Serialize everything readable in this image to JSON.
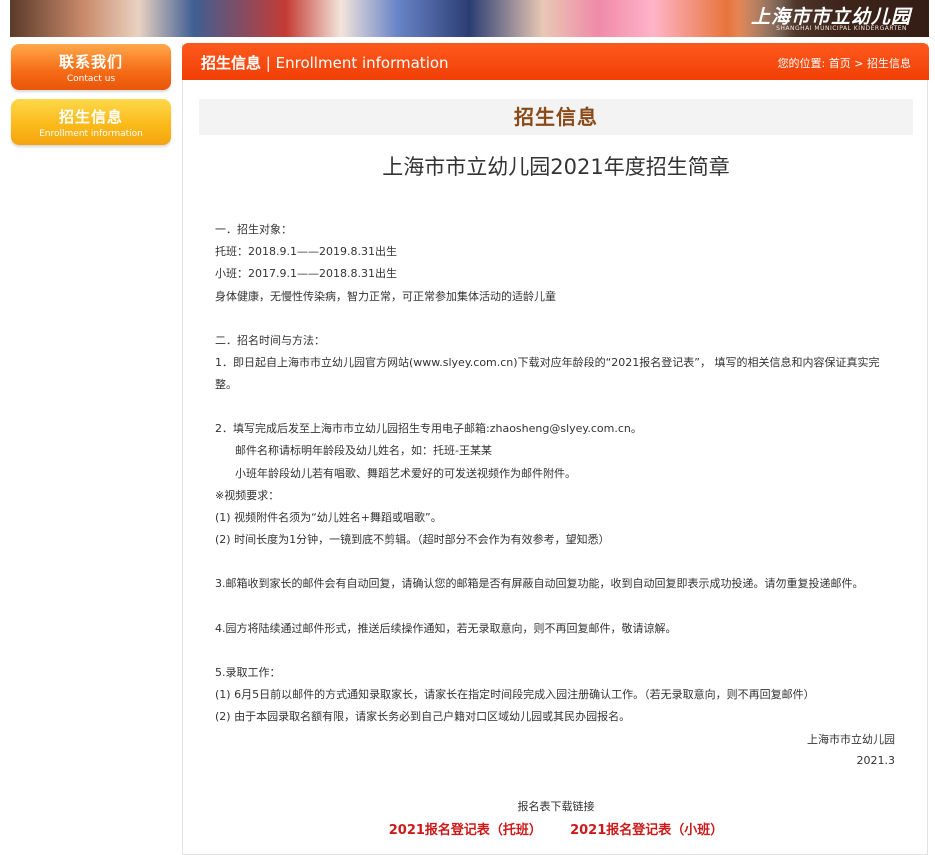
{
  "banner": {
    "logo_cn": "上海市市立幼儿园",
    "logo_en": "SHANGHAI MUNICIPAL KINDERGARTEN"
  },
  "sidebar": {
    "items": [
      {
        "label_cn": "联系我们",
        "label_en": "Contact  us"
      },
      {
        "label_cn": "招生信息",
        "label_en": "Enrollment information"
      }
    ]
  },
  "header": {
    "title_cn": "招生信息",
    "title_sep": "|",
    "title_en": "Enrollment information",
    "crumb_prefix": "您的位置:",
    "crumb_home": "首页",
    "crumb_arrow": ">",
    "crumb_current": "招生信息"
  },
  "page": {
    "heading": "招生信息",
    "doc_title": "上海市市立幼儿园2021年度招生简章"
  },
  "content": {
    "lines": [
      "一．招生对象：",
      "托班：2018.9.1——2019.8.31出生",
      "小班：2017.9.1——2018.8.31出生",
      "身体健康，无慢性传染病，智力正常，可正常参加集体活动的适龄儿童",
      "二．招名时间与方法：",
      "1．即日起自上海市市立幼儿园官方网站(www.slyey.com.cn)下载对应年龄段的“2021报名登记表”，  填写的相关信息和内容保证真实完",
      "整。",
      "2．填写完成后发至上海市市立幼儿园招生专用电子邮箱:zhaosheng@slyey.com.cn。",
      "邮件名称请标明年龄段及幼儿姓名，如：托班-王某某",
      "小班年龄段幼儿若有唱歌、舞蹈艺术爱好的可发送视频作为邮件附件。",
      "※视频要求：",
      "(1) 视频附件名须为“幼儿姓名+舞蹈或唱歌”。",
      "(2) 时间长度为1分钟，一镜到底不剪辑。（超时部分不会作为有效参考，望知悉）",
      "3.邮箱收到家长的邮件会有自动回复，请确认您的邮箱是否有屏蔽自动回复功能，收到自动回复即表示成功投递。请勿重复投递邮件。",
      "4.园方将陆续通过邮件形式，推送后续操作通知，若无录取意向，则不再回复邮件，敬请谅解。",
      "5.录取工作：",
      "(1) 6月5日前以邮件的方式通知录取家长，请家长在指定时间段完成入园注册确认工作。（若无录取意向，则不再回复邮件）",
      "(2) 由于本园录取名额有限，请家长务必到自己户籍对口区域幼儿园或其民办园报名。"
    ],
    "sign_org": "上海市市立幼儿园",
    "sign_date": "2021.3"
  },
  "downloads": {
    "title": "报名表下载链接",
    "links": [
      {
        "label": "2021报名登记表（托班）"
      },
      {
        "label": "2021报名登记表（小班）"
      }
    ]
  },
  "colors": {
    "header_red": "#f03f05",
    "heading_brown": "#8a4a18",
    "link_red": "#cc1a1a",
    "sidebar_orange": "#f66b16",
    "sidebar_yellow": "#fbb818"
  }
}
